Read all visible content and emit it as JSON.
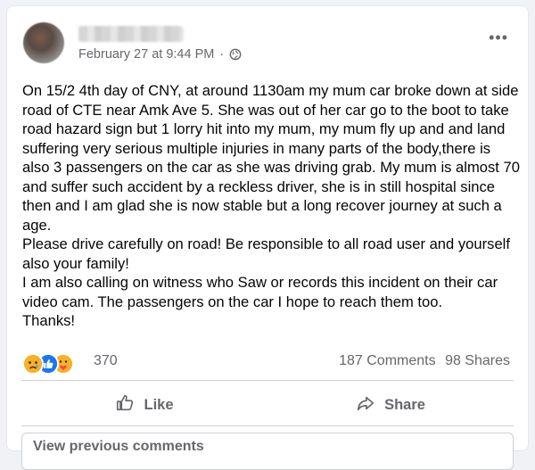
{
  "post": {
    "timestamp": "February 27 at 9:44 PM",
    "separator": "·",
    "more_label": "•••",
    "paragraphs": [
      "On 15/2 4th day of CNY, at around 1130am my mum car broke down at side road of CTE near Amk Ave 5. She was out of her car go to the boot to take road hazard sign but 1 lorry hit into my mum, my mum fly up and and land suffering very serious multiple injuries in many parts of the body,there is also 3 passengers on the car as she was driving grab. My mum is almost 70 and suffer such accident by a reckless driver, she is in still hospital since then and I am glad she is now stable but a long recover journey at such a age.",
      "Please drive carefully on road! Be responsible to all road user and yourself also your family!",
      "I am also calling on witness who Saw or records this incident on their car video cam. The passengers on the car I hope to reach them too.",
      "Thanks!"
    ]
  },
  "reactions": {
    "icons": [
      "sad-icon",
      "like-icon",
      "care-icon"
    ],
    "count": "370",
    "comments": "187 Comments",
    "shares": "98 Shares"
  },
  "actions": {
    "like_label": "Like",
    "share_label": "Share"
  },
  "comments": {
    "view_previous": "View previous comments"
  },
  "colors": {
    "like_blue": "#1877f2",
    "reaction_yellow": "#f7b125",
    "muted_text": "#65676b"
  }
}
